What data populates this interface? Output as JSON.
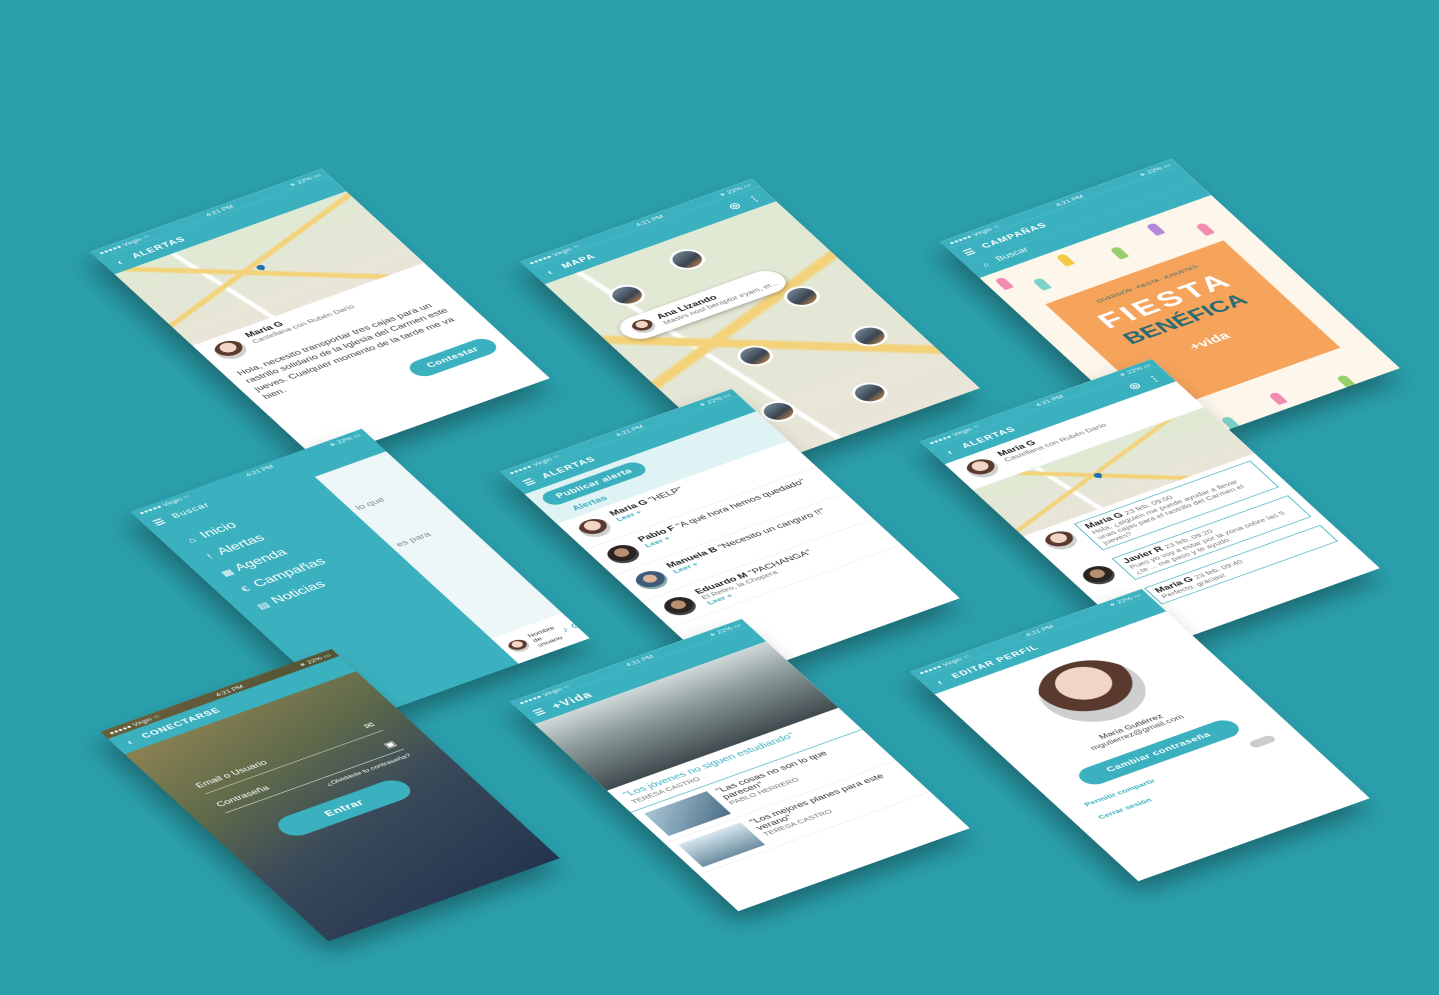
{
  "colors": {
    "background": "#2aa0ad",
    "accent": "#3bb1bf",
    "orange": "#f6a35c"
  },
  "statusbar": {
    "carrier": "●●●●● Virgin ☜",
    "time": "4:21 PM",
    "battery": "∗ 22% ▭"
  },
  "alert_detail": {
    "title": "ALERTAS",
    "user_name": "María G",
    "user_location": "Castellana con Rubén Darío",
    "message": "Hola, necesito transportar tres cajas para un rastrillo solidario de la Iglesia del Carmen este jueves. Cualquier momento de la tarde me va bien.",
    "reply_button": "Contestar"
  },
  "map_screen": {
    "title": "MAPA",
    "card_name": "Ana Lizando",
    "card_sub": "Mastrs nost beraptor iryam, et..."
  },
  "campaigns": {
    "title": "CAMPAÑAS",
    "search_placeholder": "Buscar",
    "poster_top": "· DIVERSIÓN · FIESTA · JUGUETES ·",
    "poster_title_1": "FIESTA",
    "poster_title_2": "BENÉFICA",
    "poster_brand": "+vida"
  },
  "menu": {
    "search_placeholder": "Buscar",
    "items": [
      {
        "icon": "home-icon",
        "glyph": "⌂",
        "label": "Inicio"
      },
      {
        "icon": "alert-icon",
        "glyph": "!",
        "label": "Alertas"
      },
      {
        "icon": "calendar-icon",
        "glyph": "▦",
        "label": "Agenda"
      },
      {
        "icon": "euro-icon",
        "glyph": "€",
        "label": "Campañas"
      },
      {
        "icon": "news-icon",
        "glyph": "▤",
        "label": "Noticias"
      }
    ],
    "bg_text_1": "lo que",
    "bg_text_2": "es para",
    "user_label": "Nombre de usuario"
  },
  "alerts_list": {
    "title": "ALERTAS",
    "publish_button": "Publicar alerta",
    "section_label": "Alertas",
    "read_more": "Leer +",
    "items": [
      {
        "name": "María G",
        "quote": "\"HELP\""
      },
      {
        "name": "Pablo F",
        "quote": "\"A qué hora hemos quedado\""
      },
      {
        "name": "Manuela B",
        "quote": "\"Necesito un canguro !!\""
      },
      {
        "name": "Eduardo M",
        "quote": "\"PACHANGA\"",
        "sub": "El Retiro, la Chopera"
      }
    ]
  },
  "alert_chat": {
    "title": "ALERTAS",
    "user_name": "María G",
    "user_location": "Castellana con Rubén Darío",
    "messages": [
      {
        "name": "María G",
        "time": "23 feb. 09:00",
        "text": "Hola, ¿alguien me puede ayudar a llevar unas cajas para el rastrillo del Carmen el jueves?"
      },
      {
        "name": "Javier R",
        "time": "23 feb. 09:20",
        "text": "Pues yo voy a estar por la zona sobre las 5 ¿te ... me paso y te ayudo."
      },
      {
        "name": "María G",
        "time": "23 feb. 09:40",
        "text": "Perfecto, gracias!"
      }
    ]
  },
  "login": {
    "title": "CONECTARSE",
    "email_placeholder": "Email o Usuario",
    "password_placeholder": "Contraseña",
    "forgot": "¿Olvidaste tu contraseña?",
    "enter_button": "Entrar"
  },
  "news": {
    "brand": "+Vida",
    "headline": "\"Los jóvenes no siguen estudiando\"",
    "author_1": "TERESA CASTRO",
    "item_1_title": "\"Las cosas no son lo que parecen\"",
    "item_1_author": "PABLO HERRERO",
    "item_2_title": "\"Los mejores planes para este verano\"",
    "item_2_author": "TERESA CASTRO"
  },
  "profile": {
    "title": "EDITAR PERFIL",
    "name": "María Gutiérrez",
    "email": "mgutierrez@gmail.com",
    "change_password": "Cambiar contraseña",
    "share_toggle": "Permitir compartir",
    "logout": "Cerrar sesión"
  }
}
